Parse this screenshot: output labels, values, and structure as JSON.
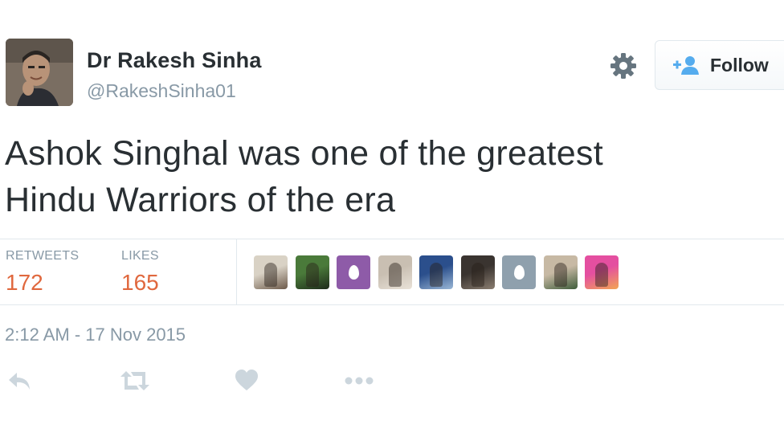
{
  "user": {
    "display_name": "Dr Rakesh Sinha",
    "handle": "@RakeshSinha01"
  },
  "follow_button": {
    "label": "Follow",
    "icon": "add-user-icon"
  },
  "settings": {
    "icon": "gear-icon"
  },
  "tweet": {
    "text_line1": "Ashok Singhal was one of the greatest",
    "text_line2": "Hindu Warriors of the era",
    "timestamp": "2:12 AM - 17 Nov 2015"
  },
  "stats": {
    "retweets_label": "RETWEETS",
    "retweets_value": "172",
    "likes_label": "LIKES",
    "likes_value": "165"
  },
  "likers": [
    {
      "type": "photo",
      "colors": [
        "#d9d2c5",
        "#6d5a4a"
      ]
    },
    {
      "type": "photo",
      "colors": [
        "#4a7a3a",
        "#1e2b1a"
      ]
    },
    {
      "type": "egg",
      "colors": [
        "#8e5ba8"
      ]
    },
    {
      "type": "photo",
      "colors": [
        "#c9bfb2",
        "#e9e2d8"
      ]
    },
    {
      "type": "photo",
      "colors": [
        "#2b4f8c",
        "#9ab7d6"
      ]
    },
    {
      "type": "photo",
      "colors": [
        "#3a3430",
        "#8a7d70"
      ]
    },
    {
      "type": "egg",
      "colors": [
        "#8fa0ad"
      ]
    },
    {
      "type": "photo",
      "colors": [
        "#c7b9a4",
        "#3e5c3a"
      ]
    },
    {
      "type": "photo",
      "colors": [
        "#e44fa0",
        "#f2a654"
      ]
    }
  ],
  "actions": {
    "reply_icon": "reply-icon",
    "retweet_icon": "retweet-icon",
    "like_icon": "heart-icon",
    "more_icon": "more-icon"
  },
  "colors": {
    "text": "#292f33",
    "secondary": "#8899a6",
    "stat_value": "#e0683e",
    "action_icon": "#ccd6dd",
    "follow_icon": "#55acee"
  }
}
